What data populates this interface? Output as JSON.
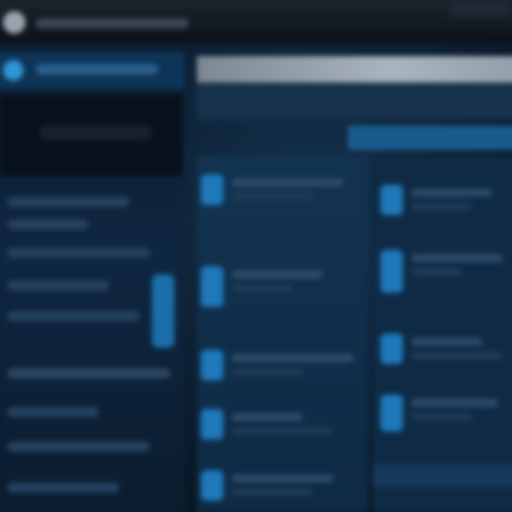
{
  "theme": {
    "background": "#060d16",
    "sidebar": "#0f2640",
    "accent": "#2f96d6",
    "highlight": "#a9b4be"
  },
  "icons": {
    "app": "app-icon",
    "sidebar_active": "nav-item-icon",
    "list_item": "list-item-icon"
  }
}
